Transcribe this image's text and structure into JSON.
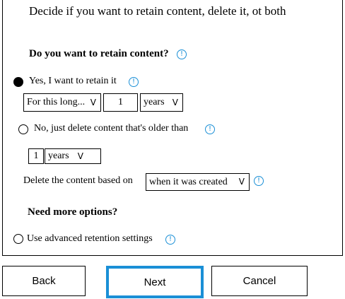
{
  "header": {
    "title": "Decide if you want to retain content, delete it, ot both"
  },
  "retain_section": {
    "heading": "Do you want to retain content?"
  },
  "options": {
    "retain": {
      "label": "Yes, I want to retain it",
      "selected": true,
      "duration_mode": "For this long...",
      "amount": "1",
      "unit": "years"
    },
    "delete_only": {
      "label": "No, just delete content that's older than",
      "selected": false,
      "amount": "1",
      "unit": "years"
    }
  },
  "based_on": {
    "label": "Delete the content based on",
    "value": "when it was created"
  },
  "more_options": {
    "heading": "Need more options?",
    "advanced_label": "Use advanced retention settings",
    "selected": false
  },
  "footer": {
    "back_label": "Back",
    "next_label": "Next",
    "cancel_label": "Cancel"
  },
  "colors": {
    "accent": "#1a8fd6"
  },
  "icons": {
    "info": "info-circle-icon",
    "caret": "chevron-down-icon"
  }
}
